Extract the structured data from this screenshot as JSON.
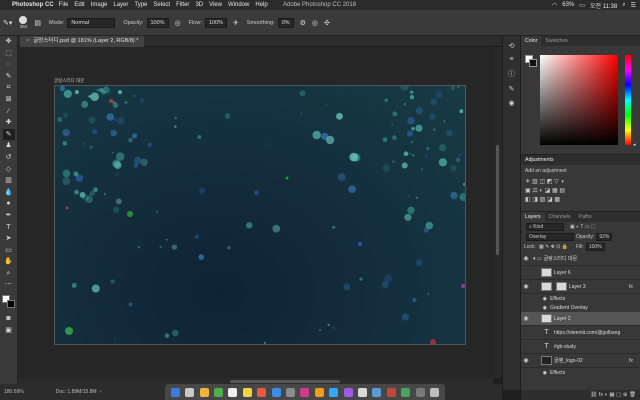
{
  "menubar": {
    "app": "Photoshop CC",
    "items": [
      "File",
      "Edit",
      "Image",
      "Layer",
      "Type",
      "Select",
      "Filter",
      "3D",
      "View",
      "Window",
      "Help"
    ],
    "window_title": "Adobe Photoshop CC 2018",
    "battery": "63%",
    "clock": "오전 11:38"
  },
  "options": {
    "brush_size": "384",
    "mode_label": "Mode:",
    "mode_value": "Normal",
    "opacity_label": "Opacity:",
    "opacity_value": "100%",
    "flow_label": "Flow:",
    "flow_value": "100%",
    "smoothing_label": "Smoothing:",
    "smoothing_value": "0%"
  },
  "document": {
    "tab_title": "글랑스터디.psd @ 181% (Layer 2, RGB/8) *",
    "label": "글랑스터디 대문"
  },
  "status": {
    "zoom": "180.69%",
    "doc": "Doc: 1.89M/15.8M"
  },
  "color_panel": {
    "tabs": [
      "Color",
      "Swatches"
    ],
    "foreground": "#ffffff",
    "background": "#111111",
    "hue_color": "#ff0000",
    "hue_picker": "◂"
  },
  "adjustments": {
    "title": "Adjustments",
    "subtitle": "Add an adjustment",
    "row1": "☀ ▥ ◫ ◩ ▽ ◑",
    "row2": "▣ ⚖ ◐ ◪ ▦ ▤",
    "row3": "◧ ◨ ▨ ◪ ▩"
  },
  "layers_panel": {
    "tabs": [
      "Layers",
      "Channels",
      "Paths"
    ],
    "kind": "Kind",
    "blend_mode": "Overlay",
    "opacity_label": "Opacity:",
    "opacity_value": "92%",
    "lock_label": "Lock:",
    "fill_label": "Fill:",
    "fill_value": "100%",
    "footer_icons": "⛓ fx ◐ ▦ ▢ ⊕ 🗑",
    "layers": [
      {
        "name": "글랑스터디 대문",
        "type": "group"
      },
      {
        "name": "Layer 6",
        "type": "layer"
      },
      {
        "name": "Layer 3",
        "type": "layer",
        "fx": "fx"
      },
      {
        "name": "Effects",
        "type": "effects"
      },
      {
        "name": "Gradient Overlay",
        "type": "effect"
      },
      {
        "name": "Layer 2",
        "type": "layer",
        "selected": true
      },
      {
        "name": "https://steemit.com/@golbang",
        "type": "text"
      },
      {
        "name": "#gb-study",
        "type": "text"
      },
      {
        "name": "골뱅_logo-02",
        "type": "layer",
        "fx": "fx"
      },
      {
        "name": "Effects",
        "type": "effects"
      }
    ]
  }
}
